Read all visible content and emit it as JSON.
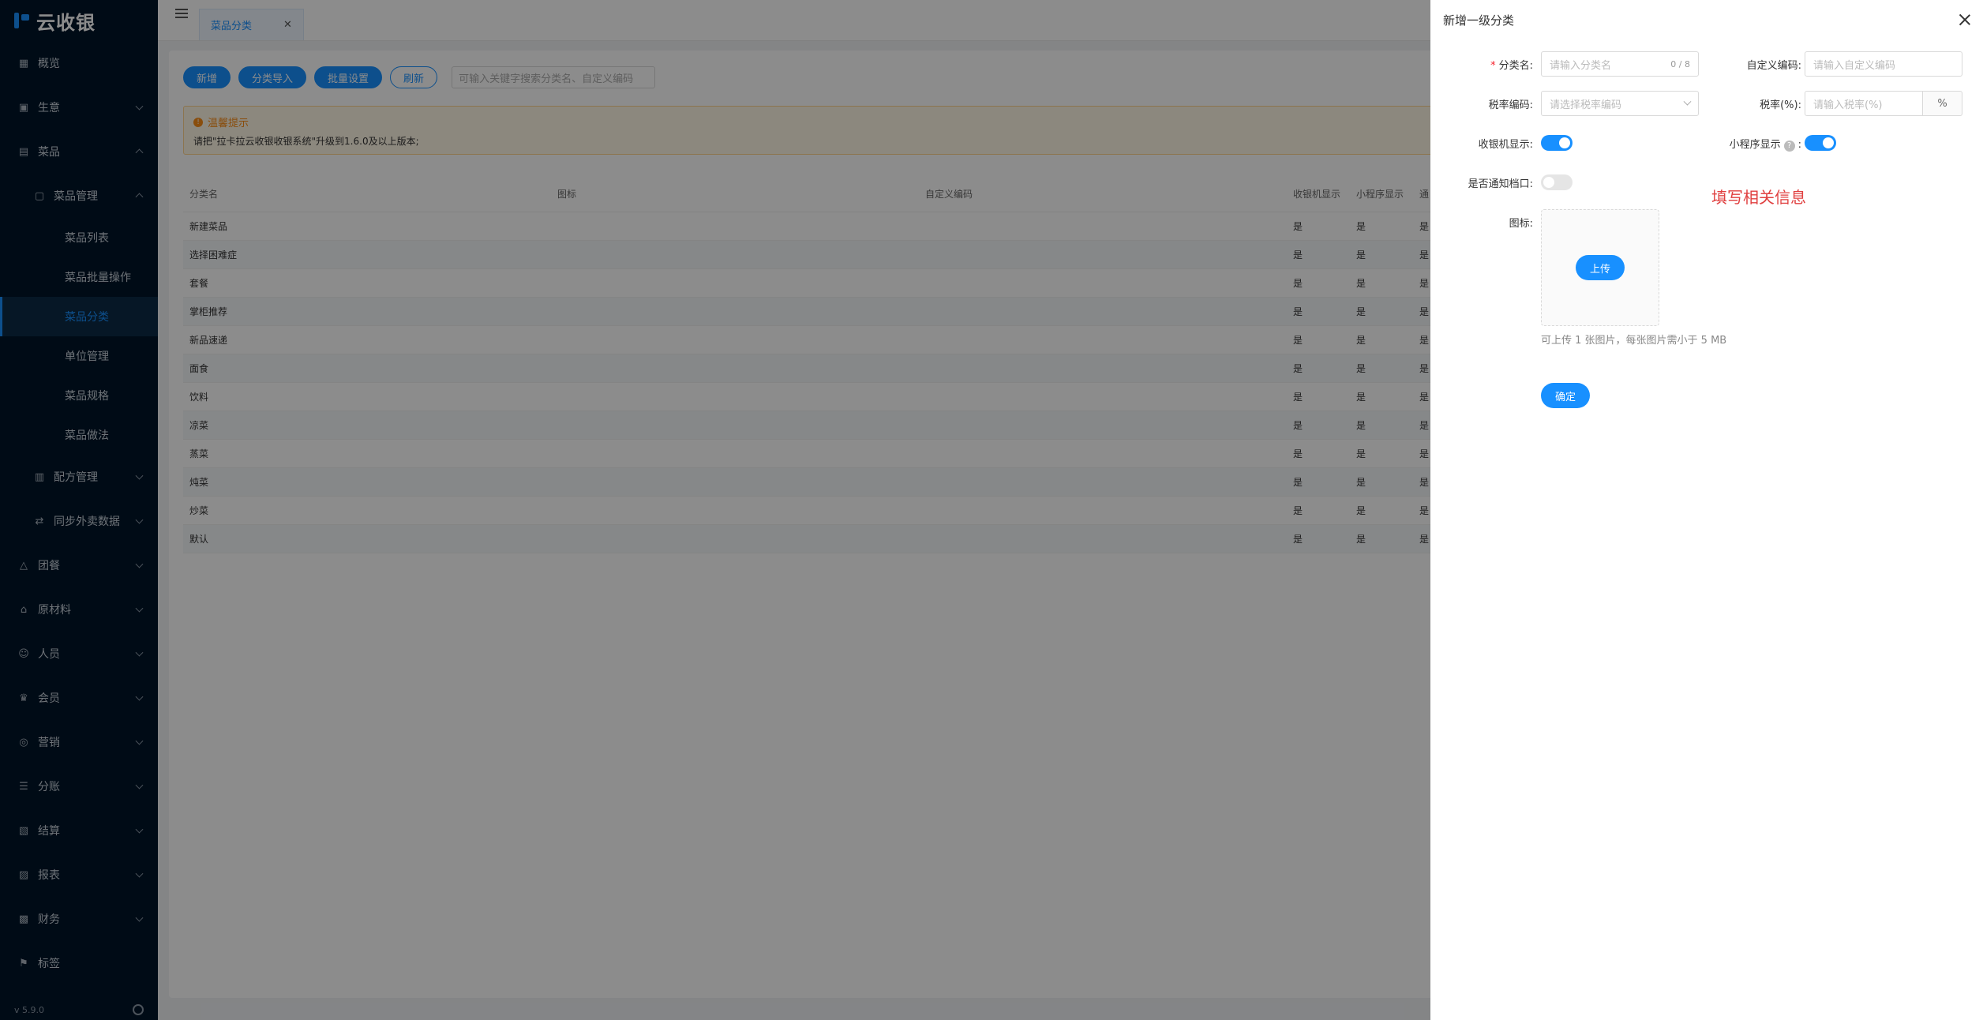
{
  "app": {
    "name": "云收银",
    "version": "v 5.9.0"
  },
  "sidebar": {
    "items": [
      {
        "label": "概览",
        "icon": "dashboard-icon"
      },
      {
        "label": "生意",
        "icon": "business-icon"
      },
      {
        "label": "菜品",
        "icon": "dish-icon"
      },
      {
        "label": "菜品管理",
        "icon": "dish-manage-icon"
      },
      {
        "label": "菜品列表"
      },
      {
        "label": "菜品批量操作"
      },
      {
        "label": "菜品分类"
      },
      {
        "label": "单位管理"
      },
      {
        "label": "菜品规格"
      },
      {
        "label": "菜品做法"
      },
      {
        "label": "配方管理",
        "icon": "recipe-icon"
      },
      {
        "label": "同步外卖数据",
        "icon": "sync-icon"
      },
      {
        "label": "团餐",
        "icon": "group-meal-icon"
      },
      {
        "label": "原材料",
        "icon": "material-icon"
      },
      {
        "label": "人员",
        "icon": "user-icon"
      },
      {
        "label": "会员",
        "icon": "member-icon"
      },
      {
        "label": "营销",
        "icon": "marketing-icon"
      },
      {
        "label": "分账",
        "icon": "split-icon"
      },
      {
        "label": "结算",
        "icon": "settle-icon"
      },
      {
        "label": "报表",
        "icon": "report-icon"
      },
      {
        "label": "财务",
        "icon": "finance-icon"
      },
      {
        "label": "标签",
        "icon": "tag-icon"
      }
    ]
  },
  "tabs": [
    {
      "label": "菜品分类"
    }
  ],
  "toolbar": {
    "new_label": "新增",
    "import_label": "分类导入",
    "batch_label": "批量设置",
    "refresh_label": "刷新",
    "search_placeholder": "可输入关键字搜索分类名、自定义编码"
  },
  "alert": {
    "title": "温馨提示",
    "content": "请把\"拉卡拉云收银收银系统\"升级到1.6.0及以上版本;"
  },
  "table": {
    "headers": [
      "分类名",
      "图标",
      "自定义编码",
      "收银机显示",
      "小程序显示",
      "通"
    ],
    "rows": [
      {
        "name": "新建菜品",
        "cashier": "是",
        "mini": "是",
        "notify": "是"
      },
      {
        "name": "选择困难症",
        "cashier": "是",
        "mini": "是",
        "notify": "是"
      },
      {
        "name": "套餐",
        "cashier": "是",
        "mini": "是",
        "notify": "是"
      },
      {
        "name": "掌柜推荐",
        "cashier": "是",
        "mini": "是",
        "notify": "是"
      },
      {
        "name": "新品速递",
        "cashier": "是",
        "mini": "是",
        "notify": "是"
      },
      {
        "name": "面食",
        "cashier": "是",
        "mini": "是",
        "notify": "是"
      },
      {
        "name": "饮料",
        "cashier": "是",
        "mini": "是",
        "notify": "是"
      },
      {
        "name": "凉菜",
        "cashier": "是",
        "mini": "是",
        "notify": "是"
      },
      {
        "name": "蒸菜",
        "cashier": "是",
        "mini": "是",
        "notify": "是"
      },
      {
        "name": "炖菜",
        "cashier": "是",
        "mini": "是",
        "notify": "是"
      },
      {
        "name": "炒菜",
        "cashier": "是",
        "mini": "是",
        "notify": "是"
      },
      {
        "name": "默认",
        "cashier": "是",
        "mini": "是",
        "notify": "是"
      }
    ]
  },
  "drawer": {
    "title": "新增一级分类",
    "name_label": "分类名:",
    "name_placeholder": "请输入分类名",
    "name_count": "0 / 8",
    "code_label": "自定义编码:",
    "code_placeholder": "请输入自定义编码",
    "tax_code_label": "税率编码:",
    "tax_code_placeholder": "请选择税率编码",
    "tax_rate_label": "税率(%):",
    "tax_rate_placeholder": "请输入税率(%)",
    "tax_rate_unit": "%",
    "cashier_label": "收银机显示:",
    "mini_label": "小程序显示",
    "mini_colon": ":",
    "help_glyph": "?",
    "notify_label": "是否通知档口:",
    "icon_label": "图标:",
    "upload_label": "上传",
    "upload_tip": "可上传 1 张图片，每张图片需小于 5 MB",
    "confirm_label": "确定",
    "annotation": "填写相关信息",
    "cashier_on": true,
    "mini_on": true,
    "notify_on": false
  },
  "colors": {
    "primary": "#1890ff",
    "sidebar": "#001529",
    "annotation": "#e04040"
  }
}
